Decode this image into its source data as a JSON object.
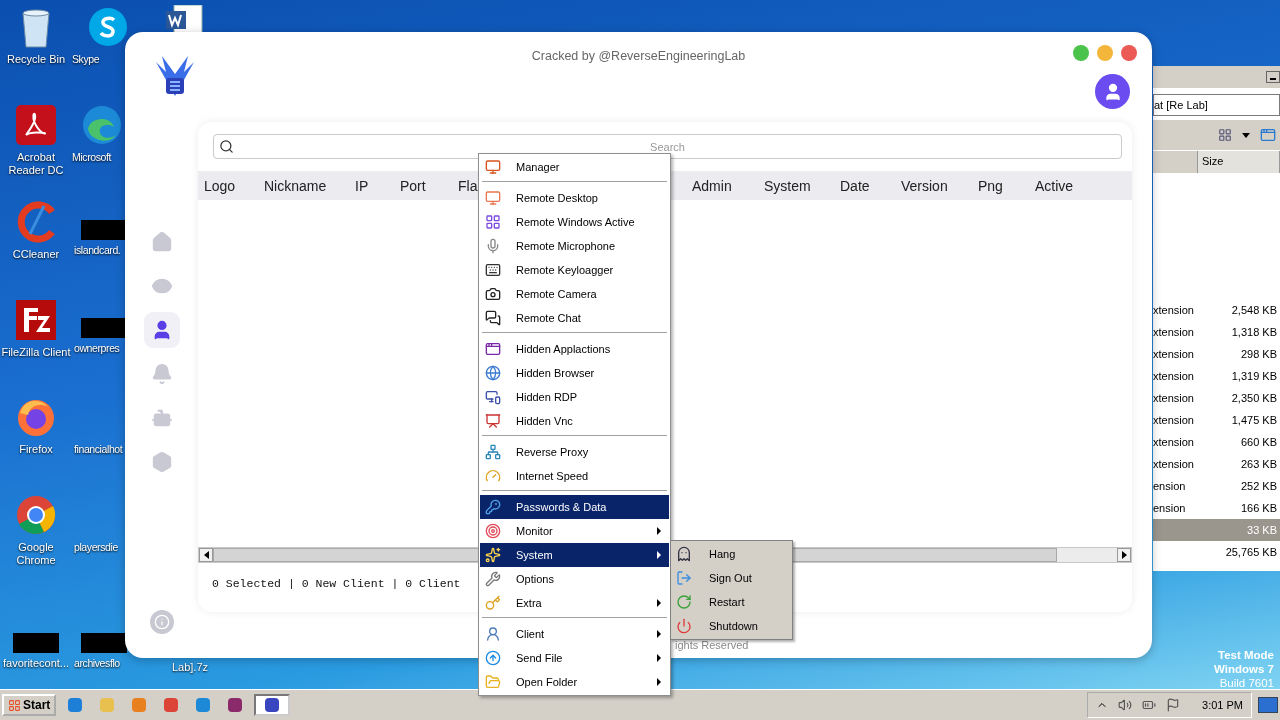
{
  "desktop_icons": [
    {
      "label": "Recycle Bin",
      "kind": "recycle-bin"
    },
    {
      "label": "Skype",
      "kind": "skype"
    },
    {
      "kind": "word"
    },
    {
      "label": "Acrobat Reader DC",
      "kind": "acrobat"
    },
    {
      "label": "Microsoft",
      "kind": "edge"
    },
    {
      "label": "CCleaner",
      "kind": "ccleaner"
    },
    {
      "label": "islandcard.",
      "kind": "redacted"
    },
    {
      "label": "FileZilla Client",
      "kind": "filezilla"
    },
    {
      "label": "ownerpres",
      "kind": "redacted"
    },
    {
      "label": "Firefox",
      "kind": "firefox"
    },
    {
      "label": "financialhot",
      "kind": "blank"
    },
    {
      "label": "Google Chrome",
      "kind": "chrome"
    },
    {
      "label": "playersdie",
      "kind": "blank"
    },
    {
      "label": "favoritecont...",
      "kind": "redacted"
    },
    {
      "label": "archivesflo",
      "kind": "redacted"
    },
    {
      "label": "Lab].7z",
      "kind": "blank"
    }
  ],
  "system_notice": [
    "Test Mode",
    "Windows 7",
    "Build 7601"
  ],
  "explorer": {
    "address": "at [Re Lab]",
    "column": "Size",
    "rows": [
      {
        "type": "xtension",
        "size": "2,548 KB",
        "selected": false
      },
      {
        "type": "xtension",
        "size": "1,318 KB",
        "selected": false
      },
      {
        "type": "xtension",
        "size": "298 KB",
        "selected": false
      },
      {
        "type": "xtension",
        "size": "1,319 KB",
        "selected": false
      },
      {
        "type": "xtension",
        "size": "2,350 KB",
        "selected": false
      },
      {
        "type": "xtension",
        "size": "1,475 KB",
        "selected": false
      },
      {
        "type": "xtension",
        "size": "660 KB",
        "selected": false
      },
      {
        "type": "xtension",
        "size": "263 KB",
        "selected": false
      },
      {
        "type": "ension",
        "size": "252 KB",
        "selected": false
      },
      {
        "type": "ension",
        "size": "166 KB",
        "selected": false
      },
      {
        "size": "33 KB",
        "selected": true
      },
      {
        "size": "25,765 KB",
        "selected": false
      }
    ]
  },
  "app": {
    "title": "Cracked by @ReverseEngineeringLab",
    "nav": [
      {
        "kind": "home",
        "selected": false
      },
      {
        "kind": "eye",
        "selected": false
      },
      {
        "kind": "user",
        "selected": true
      },
      {
        "kind": "bell",
        "selected": false
      },
      {
        "kind": "robot",
        "selected": false
      },
      {
        "kind": "hexagon",
        "selected": false
      }
    ],
    "search": {
      "placeholder": "Search"
    },
    "columns": [
      "Logo",
      "Nickname",
      "IP",
      "Port",
      "Fla",
      "Admin",
      "System",
      "Date",
      "Version",
      "Png",
      "Active"
    ],
    "status": "0 Selected | 0 New Client | 0 Client",
    "footer": "ights Reserved"
  },
  "context_menu": {
    "sections": [
      [
        {
          "label": "Manager",
          "highlighted": false,
          "submenu": false
        }
      ],
      [
        {
          "label": "Remote Desktop",
          "highlighted": false,
          "submenu": false
        },
        {
          "label": "Remote Windows Active",
          "highlighted": false,
          "submenu": false
        },
        {
          "label": "Remote Microphone",
          "highlighted": false,
          "submenu": false
        },
        {
          "label": "Remote Keyloagger",
          "highlighted": false,
          "submenu": false
        },
        {
          "label": "Remote Camera",
          "highlighted": false,
          "submenu": false
        },
        {
          "label": "Remote Chat",
          "highlighted": false,
          "submenu": false
        }
      ],
      [
        {
          "label": "Hidden Applactions",
          "highlighted": false,
          "submenu": false
        },
        {
          "label": "Hidden Browser",
          "highlighted": false,
          "submenu": false
        },
        {
          "label": "Hidden RDP",
          "highlighted": false,
          "submenu": false
        },
        {
          "label": "Hidden Vnc",
          "highlighted": false,
          "submenu": false
        }
      ],
      [
        {
          "label": "Reverse Proxy",
          "highlighted": false,
          "submenu": false
        },
        {
          "label": "Internet Speed",
          "highlighted": false,
          "submenu": false
        }
      ],
      [
        {
          "label": "Passwords & Data",
          "highlighted": true,
          "submenu": false
        },
        {
          "label": "Monitor",
          "highlighted": false,
          "submenu": true
        },
        {
          "label": "System",
          "highlighted": true,
          "submenu": true
        },
        {
          "label": "Options",
          "highlighted": false,
          "submenu": false
        },
        {
          "label": "Extra",
          "highlighted": false,
          "submenu": true
        }
      ],
      [
        {
          "label": "Client",
          "highlighted": false,
          "submenu": true
        },
        {
          "label": "Send File",
          "highlighted": false,
          "submenu": true
        },
        {
          "label": "Open Folder",
          "highlighted": false,
          "submenu": true
        }
      ]
    ]
  },
  "submenu": {
    "items": [
      "Hang",
      "Sign Out",
      "Restart",
      "Shutdown"
    ]
  },
  "taskbar": {
    "start": "Start",
    "apps": [
      {
        "kind": "ie",
        "selected": false
      },
      {
        "kind": "explorer",
        "selected": false
      },
      {
        "kind": "media",
        "selected": false
      },
      {
        "kind": "chrome",
        "selected": false
      },
      {
        "kind": "edge",
        "selected": false
      },
      {
        "kind": "archive",
        "selected": false
      },
      {
        "kind": "app",
        "selected": true
      }
    ],
    "clock": "3:01 PM"
  }
}
